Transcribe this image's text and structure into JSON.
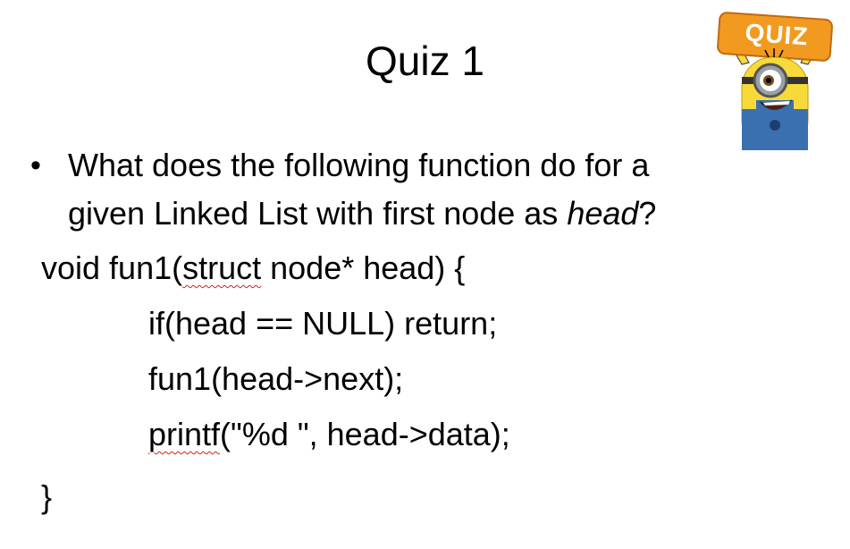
{
  "slide": {
    "title": "Quiz 1",
    "question": {
      "part1": "What does the following function do for a",
      "part2": "given Linked List with first node as ",
      "part2_italic": "head",
      "part2_end": "?"
    },
    "code": {
      "line1_a": "void fun1(",
      "line1_b": "struct",
      "line1_c": " node* head) {",
      "line2": "if(head == NULL) return;",
      "line3": "fun1(head->next);",
      "line4_a": "printf",
      "line4_b": "(\"%d \", head->data);",
      "line5": "}"
    },
    "badge": {
      "text": "QUIZ"
    }
  },
  "colors": {
    "badge_orange": "#f29a1f",
    "minion_yellow": "#f7d93a",
    "overalls_blue": "#3a6fb0",
    "spellcheck_red": "#d62020"
  },
  "icons": {
    "mascot": "minion-holding-quiz-sign-icon",
    "bullet": "bullet-dot"
  }
}
